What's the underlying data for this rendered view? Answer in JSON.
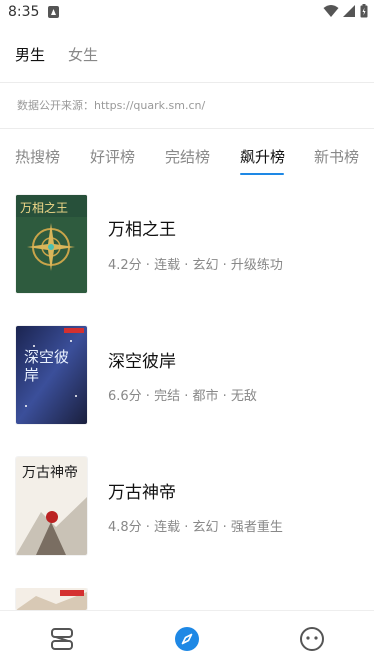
{
  "status": {
    "time": "8:35"
  },
  "gender_tabs": [
    {
      "label": "男生",
      "active": true
    },
    {
      "label": "女生",
      "active": false
    }
  ],
  "source_text": "数据公开来源：https://quark.sm.cn/",
  "rank_tabs": [
    {
      "label": "热搜榜",
      "active": false
    },
    {
      "label": "好评榜",
      "active": false
    },
    {
      "label": "完结榜",
      "active": false
    },
    {
      "label": "飙升榜",
      "active": true
    },
    {
      "label": "新书榜",
      "active": false
    }
  ],
  "books": [
    {
      "title": "万相之王",
      "meta": "4.2分 · 连载 · 玄幻 · 升级练功",
      "cover_text": "万相之王"
    },
    {
      "title": "深空彼岸",
      "meta": "6.6分 · 完结 · 都市 · 无敌",
      "cover_text": "深空彼岸"
    },
    {
      "title": "万古神帝",
      "meta": "4.8分 · 连载 · 玄幻 · 强者重生",
      "cover_text": "万古神帝"
    }
  ],
  "colors": {
    "accent": "#1e88e5",
    "active_text": "#111111",
    "inactive_text": "#888888"
  },
  "bottom_nav": [
    {
      "icon": "bookshelf-icon",
      "active": false
    },
    {
      "icon": "discover-compass-icon",
      "active": true
    },
    {
      "icon": "profile-face-icon",
      "active": false
    }
  ]
}
